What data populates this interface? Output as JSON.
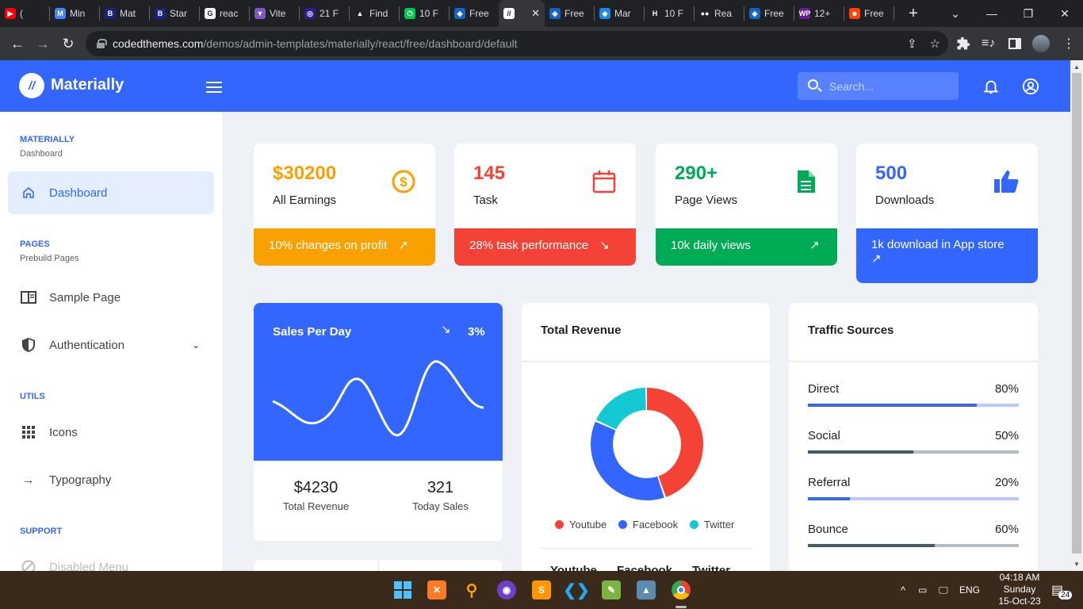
{
  "browser": {
    "tabs": [
      {
        "label": "(",
        "fav": "#ff0000",
        "glyph": "▶"
      },
      {
        "label": "Min",
        "fav": "#4285f4",
        "glyph": "M"
      },
      {
        "label": "Mat",
        "fav": "#1a237e",
        "glyph": "B"
      },
      {
        "label": "Star",
        "fav": "#1a237e",
        "glyph": "B"
      },
      {
        "label": "reac",
        "fav": "#ffffff",
        "glyph": "G"
      },
      {
        "label": "Vite",
        "fav": "#7e57c2",
        "glyph": "▼"
      },
      {
        "label": "21 F",
        "fav": "#311b92",
        "glyph": "◎"
      },
      {
        "label": "Find",
        "fav": "#202124",
        "glyph": "▲"
      },
      {
        "label": "10 F",
        "fav": "#00c853",
        "glyph": "⏻"
      },
      {
        "label": "Free",
        "fav": "#1565c0",
        "glyph": "◈"
      },
      {
        "label": "",
        "fav": "#ffffff",
        "glyph": "//",
        "active": true
      },
      {
        "label": "Free",
        "fav": "#1565c0",
        "glyph": "◈"
      },
      {
        "label": "Mar",
        "fav": "#1e88e5",
        "glyph": "◆"
      },
      {
        "label": "10 F",
        "fav": "#202124",
        "glyph": "H"
      },
      {
        "label": "Rea",
        "fav": "#202124",
        "glyph": "●●"
      },
      {
        "label": "Free",
        "fav": "#1565c0",
        "glyph": "◈"
      },
      {
        "label": "12+",
        "fav": "#6a1b9a",
        "glyph": "WP"
      },
      {
        "label": "Free",
        "fav": "#ff4500",
        "glyph": "☻"
      }
    ],
    "url_host": "codedthemes.com",
    "url_path": "/demos/admin-templates/materially/react/free/dashboard/default"
  },
  "header": {
    "brand": "Materially",
    "search_placeholder": "Search..."
  },
  "sidebar": {
    "materially_title": "MATERIALLY",
    "materially_sub": "Dashboard",
    "dashboard": "Dashboard",
    "pages_title": "PAGES",
    "pages_sub": "Prebuild Pages",
    "sample_page": "Sample Page",
    "authentication": "Authentication",
    "utils_title": "UTILS",
    "icons": "Icons",
    "typography": "Typography",
    "support_title": "SUPPORT",
    "disabled_menu": "Disabled Menu"
  },
  "stats": [
    {
      "value": "$30200",
      "label": "All Earnings",
      "footer": "10% changes on profit",
      "color": "#f9a100",
      "trend": "up"
    },
    {
      "value": "145",
      "label": "Task",
      "footer": "28% task performance",
      "color": "#f44236",
      "trend": "down"
    },
    {
      "value": "290+",
      "label": "Page Views",
      "footer": "10k daily views",
      "color": "#00ab55",
      "trend": "up"
    },
    {
      "value": "500",
      "label": "Downloads",
      "footer": "1k download in App store",
      "color": "#3366ff",
      "trend": "up"
    }
  ],
  "sales": {
    "title": "Sales Per Day",
    "percent": "3%",
    "revenue_value": "$4230",
    "revenue_label": "Total Revenue",
    "sales_value": "321",
    "sales_label": "Today Sales"
  },
  "revenue": {
    "title": "Total Revenue",
    "legend": [
      {
        "name": "Youtube",
        "color": "#f44236",
        "share": 0.45
      },
      {
        "name": "Facebook",
        "color": "#3366ff",
        "share": 0.37
      },
      {
        "name": "Twitter",
        "color": "#13c9d4",
        "share": 0.18
      }
    ],
    "footer_cols": [
      "Youtube",
      "Facebook",
      "Twitter"
    ]
  },
  "traffic": {
    "title": "Traffic Sources",
    "items": [
      {
        "name": "Direct",
        "pct": "80%",
        "value": 0.8,
        "color": "#3366ff",
        "track": "#b9c9ff"
      },
      {
        "name": "Social",
        "pct": "50%",
        "value": 0.5,
        "color": "#455a64",
        "track": "#b0bec5"
      },
      {
        "name": "Referral",
        "pct": "20%",
        "value": 0.2,
        "color": "#3366ff",
        "track": "#b9c9ff"
      },
      {
        "name": "Bounce",
        "pct": "60%",
        "value": 0.6,
        "color": "#455a64",
        "track": "#b0bec5"
      }
    ]
  },
  "taskbar": {
    "lang": "ENG",
    "time": "04:18 AM",
    "day": "Sunday",
    "date": "15-Oct-23",
    "notifications": "24"
  }
}
